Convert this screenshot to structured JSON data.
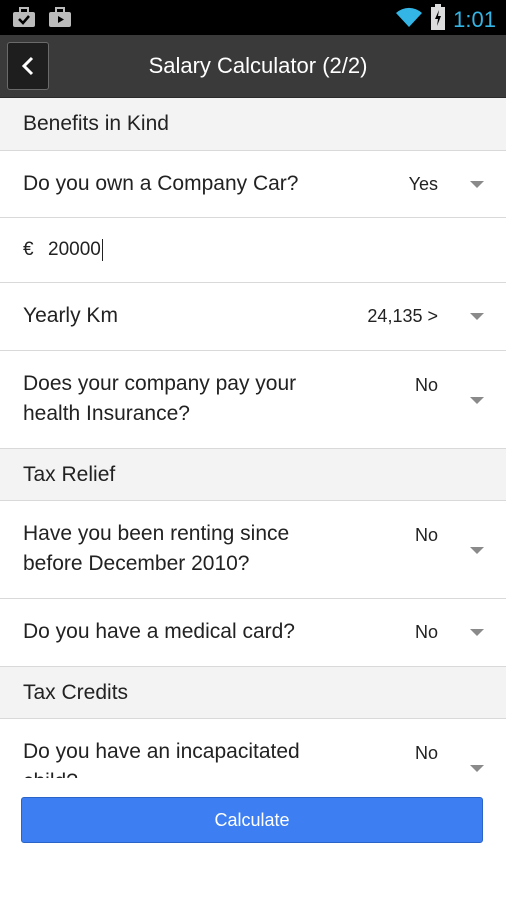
{
  "status_bar": {
    "time": "1:01",
    "icons": [
      "briefcase-check-icon",
      "briefcase-play-icon",
      "wifi-icon",
      "battery-charging-icon"
    ]
  },
  "app_bar": {
    "title": "Salary Calculator (2/2)",
    "back_icon": "chevron-left-icon"
  },
  "sections": {
    "benefits": {
      "header": "Benefits in Kind",
      "company_car": {
        "label": "Do you own a Company Car?",
        "value": "Yes"
      },
      "car_value": {
        "currency": "€",
        "amount": "20000"
      },
      "yearly_km": {
        "label": "Yearly Km",
        "value": "24,135 >"
      },
      "health_insurance": {
        "label_line1": "Does your company pay your",
        "label_line2": "health Insurance?",
        "value": "No"
      }
    },
    "tax_relief": {
      "header": "Tax Relief",
      "renting": {
        "label_line1": "Have you been renting since",
        "label_line2": "before December 2010?",
        "value": "No"
      },
      "medical_card": {
        "label": "Do you have a medical card?",
        "value": "No"
      }
    },
    "tax_credits": {
      "header": "Tax Credits",
      "incapacitated_child": {
        "label_line1": "Do you have an incapacitated",
        "label_line2": "child?",
        "value": "No"
      }
    }
  },
  "calculate_button": {
    "label": "Calculate"
  },
  "colors": {
    "accent": "#33b5e5",
    "button": "#3d7ff2",
    "appbar": "#3a3a3a",
    "section_bg": "#f3f3f3"
  }
}
